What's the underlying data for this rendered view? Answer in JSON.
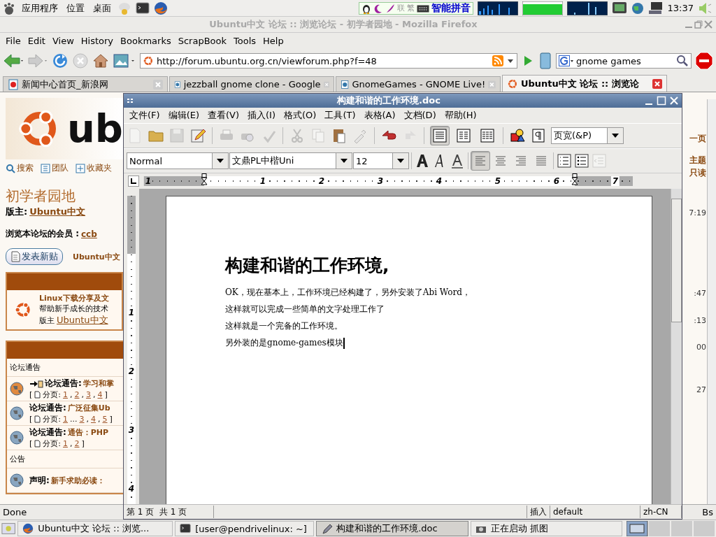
{
  "top_panel": {
    "menus": [
      "应用程序",
      "位置",
      "桌面"
    ],
    "ime_keys": [
      "联",
      "繁"
    ],
    "input_method": "智能拼音",
    "clock": "13:37"
  },
  "firefox": {
    "title": "Ubuntu中文 论坛 :: 浏览论坛 - 初学者园地 - Mozilla Firefox",
    "menu": [
      "File",
      "Edit",
      "View",
      "History",
      "Bookmarks",
      "ScrapBook",
      "Tools",
      "Help"
    ],
    "url": "http://forum.ubuntu.org.cn/viewforum.php?f=48",
    "search": "gnome games",
    "tabs": [
      {
        "label": "新闻中心首页_新浪网",
        "selected": false
      },
      {
        "label": "jezzball gnome clone - Google",
        "selected": false
      },
      {
        "label": "GnomeGames - GNOME Live!",
        "selected": false
      },
      {
        "label": "Ubuntu中文 论坛 :: 浏览论",
        "selected": true
      }
    ],
    "status": "Done",
    "status_right": "Bs"
  },
  "forum": {
    "logo_text": "ub",
    "nav_links": [
      "搜索",
      "团队",
      "收藏夹"
    ],
    "forum_title": "初学者园地",
    "moderator_label": "版主:",
    "moderator": "Ubuntu中文",
    "viewers_label": "浏览本论坛的会员 :",
    "viewers": "ccb",
    "new_post_button": "发表新贴",
    "breadcrumb": "Ubuntu中文",
    "subforum": {
      "title": "Linux下载分享及文",
      "description": "帮助新手成长的技术",
      "moderator_label": "版主",
      "moderator": "Ubuntu中文"
    },
    "sections": [
      {
        "heading": "论坛通告",
        "topics": [
          {
            "prefix": "论坛通告:",
            "title": "学习和掌",
            "moved": true,
            "pages_open": "[",
            "pages_label": "分页:",
            "pages_close": "]",
            "pages": [
              {
                "kind": "link",
                "text": "1",
                "sep": ","
              },
              {
                "kind": "link",
                "text": "2",
                "sep": ","
              },
              {
                "kind": "link",
                "text": "3",
                "sep": ","
              },
              {
                "kind": "link",
                "text": "4"
              }
            ]
          },
          {
            "prefix": "论坛通告:",
            "title": "广泛征集Ub",
            "moved": false,
            "pages_open": "[",
            "pages_label": "分页:",
            "pages_close": "]",
            "pages": [
              {
                "kind": "link",
                "text": "1"
              },
              {
                "kind": "gap",
                "text": "..."
              },
              {
                "kind": "link",
                "text": "3",
                "sep": ","
              },
              {
                "kind": "link",
                "text": "4",
                "sep": ","
              },
              {
                "kind": "link",
                "text": "5"
              }
            ]
          },
          {
            "prefix": "论坛通告:",
            "title": "通告：PHP",
            "moved": false,
            "pages_open": "[",
            "pages_label": "分页:",
            "pages_close": "]",
            "pages": [
              {
                "kind": "link",
                "text": "1",
                "sep": ","
              },
              {
                "kind": "link",
                "text": "2"
              }
            ]
          }
        ]
      },
      {
        "heading": "公告",
        "topics": [
          {
            "prefix": "声明:",
            "title": "新手求助必读：",
            "moved": false
          }
        ]
      }
    ],
    "right_fragments": [
      "一页",
      "主题",
      "只读",
      "7:19",
      ":47",
      ":13",
      "00",
      "27"
    ]
  },
  "abiword": {
    "title": "构建和谐的工作环境.doc",
    "menu": [
      "文件(F)",
      "编辑(E)",
      "查看(V)",
      "插入(I)",
      "格式(O)",
      "工具(T)",
      "表格(A)",
      "文档(D)",
      "帮助(H)"
    ],
    "view_buttons": [
      {
        "selected": true
      },
      {
        "selected": false
      },
      {
        "selected": false
      }
    ],
    "zoom": "页宽(&P)",
    "style": "Normal",
    "font": "文鼎PL中楷Uni",
    "size": "12",
    "align_buttons": [
      {
        "selected": true
      },
      {
        "selected": false
      },
      {
        "selected": false
      },
      {
        "selected": false
      }
    ],
    "ruler_numbers": [
      "1",
      "1",
      "2",
      "3",
      "4",
      "5",
      "6",
      "7"
    ],
    "vruler_numbers": [
      "1",
      "2",
      "3",
      "4"
    ],
    "heading": "构建和谐的工作环境,",
    "paragraphs": [
      "OK，现在基本上，工作环境已经构建了，另外安装了Abi Word，",
      "这样就可以完成一些简单的文字处理工作了",
      "这样就是一个完备的工作环境。",
      "另外装的是gnome-games模块"
    ],
    "status": {
      "pages": "第 1 页  共 1 页",
      "mode": "插入",
      "style": "default",
      "language": "zh-CN"
    }
  },
  "taskbar": [
    {
      "label": "Ubuntu中文 论坛 :: 浏览...",
      "selected": false
    },
    {
      "label": "[user@pendrivelinux: ~]",
      "selected": false
    },
    {
      "label": "构建和谐的工作环境.doc",
      "selected": true
    },
    {
      "label": "正在启动 抓图",
      "selected": false
    }
  ]
}
